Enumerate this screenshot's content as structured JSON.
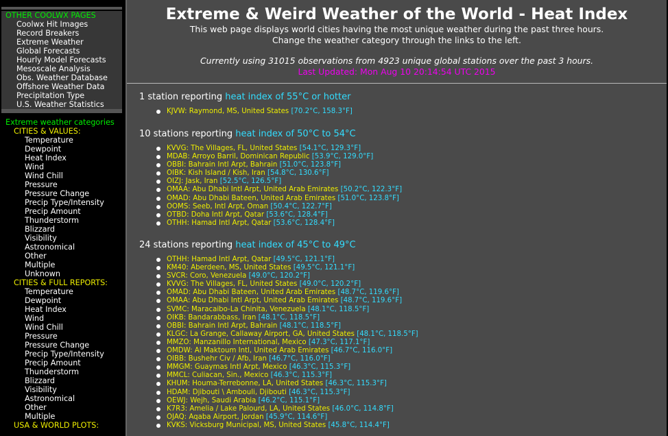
{
  "sidebar": {
    "coolwx": {
      "title": "OTHER COOLWX PAGES",
      "links": [
        "Coolwx Hit Images",
        "Record Breakers",
        "Extreme Weather",
        "Global Forecasts",
        "Hourly Model Forecasts",
        "Mesoscale Analysis",
        "Obs. Weather Database",
        "Offshore Weather Data",
        "Precipitation Type",
        "U.S. Weather Statistics"
      ]
    },
    "extreme": {
      "title": "Extreme weather categories",
      "cities_values": {
        "title": "CITIES & VALUES:",
        "links": [
          "Temperature",
          "Dewpoint",
          "Heat Index",
          "Wind",
          "Wind Chill",
          "Pressure",
          "Pressure Change",
          "Precip Type/Intensity",
          "Precip Amount",
          "Thunderstorm",
          "Blizzard",
          "Visibility",
          "Astronomical",
          "Other",
          "Multiple",
          "Unknown"
        ]
      },
      "cities_full": {
        "title": "CITIES & FULL REPORTS:",
        "links": [
          "Temperature",
          "Dewpoint",
          "Heat Index",
          "Wind",
          "Wind Chill",
          "Pressure",
          "Pressure Change",
          "Precip Type/Intensity",
          "Precip Amount",
          "Thunderstorm",
          "Blizzard",
          "Visibility",
          "Astronomical",
          "Other",
          "Multiple"
        ]
      },
      "usa_world": {
        "title": "USA & WORLD PLOTS:"
      }
    }
  },
  "main": {
    "title": "Extreme & Weird Weather of the World - Heat Index",
    "intro_1": "This web page displays world cities having the most unique weather during the past three hours.",
    "intro_2": "Change the weather category through the links to the left.",
    "obs_line": "Currently using 31015 observations from 4923 unique global stations over the past 3 hours.",
    "last_updated": "Last Updated: Mon Aug 10 20:14:54 UTC 2015",
    "groups": [
      {
        "count": "1 station reporting",
        "range": "heat index of 55°C or hotter",
        "stations": [
          {
            "name": "KJVW: Raymond, MS, United States",
            "vals": "[70.2°C, 158.3°F]"
          }
        ]
      },
      {
        "count": "10 stations reporting",
        "range": "heat index of 50°C to 54°C",
        "stations": [
          {
            "name": "KVVG: The Villages, FL, United States",
            "vals": "[54.1°C, 129.3°F]"
          },
          {
            "name": "MDAB: Arroyo Barril, Dominican Republic",
            "vals": "[53.9°C, 129.0°F]"
          },
          {
            "name": "OBBI: Bahrain Intl Arpt, Bahrain",
            "vals": "[51.0°C, 123.8°F]"
          },
          {
            "name": "OIBK: Kish Island / Kish, Iran",
            "vals": "[54.8°C, 130.6°F]"
          },
          {
            "name": "OIZJ: Jask, Iran",
            "vals": "[52.5°C, 126.5°F]"
          },
          {
            "name": "OMAA: Abu Dhabi Intl Arpt, United Arab Emirates",
            "vals": "[50.2°C, 122.3°F]"
          },
          {
            "name": "OMAD: Abu Dhabi Bateen, United Arab Emirates",
            "vals": "[51.0°C, 123.8°F]"
          },
          {
            "name": "OOMS: Seeb, Intl Arpt, Oman",
            "vals": "[50.4°C, 122.7°F]"
          },
          {
            "name": "OTBD: Doha Intl Arpt, Qatar",
            "vals": "[53.6°C, 128.4°F]"
          },
          {
            "name": "OTHH: Hamad Intl Arpt, Qatar",
            "vals": "[53.6°C, 128.4°F]"
          }
        ]
      },
      {
        "count": "24 stations reporting",
        "range": "heat index of 45°C to 49°C",
        "stations": [
          {
            "name": "OTHH: Hamad Intl Arpt, Qatar",
            "vals": "[49.5°C, 121.1°F]"
          },
          {
            "name": "KM40: Aberdeen, MS, United States",
            "vals": "[49.5°C, 121.1°F]"
          },
          {
            "name": "SVCR: Coro, Venezuela",
            "vals": "[49.0°C, 120.2°F]"
          },
          {
            "name": "KVVG: The Villages, FL, United States",
            "vals": "[49.0°C, 120.2°F]"
          },
          {
            "name": "OMAD: Abu Dhabi Bateen, United Arab Emirates",
            "vals": "[48.7°C, 119.6°F]"
          },
          {
            "name": "OMAA: Abu Dhabi Intl Arpt, United Arab Emirates",
            "vals": "[48.7°C, 119.6°F]"
          },
          {
            "name": "SVMC: Maracaibo-La Chinita, Venezuela",
            "vals": "[48.1°C, 118.5°F]"
          },
          {
            "name": "OIKB: Bandarabbass, Iran",
            "vals": "[48.1°C, 118.5°F]"
          },
          {
            "name": "OBBI: Bahrain Intl Arpt, Bahrain",
            "vals": "[48.1°C, 118.5°F]"
          },
          {
            "name": "KLGC: La Grange, Callaway Airport, GA, United States",
            "vals": "[48.1°C, 118.5°F]"
          },
          {
            "name": "MMZO: Manzanillo International, Mexico",
            "vals": "[47.3°C, 117.1°F]"
          },
          {
            "name": "OMDW: Al Maktoum Intl, United Arab Emirates",
            "vals": "[46.7°C, 116.0°F]"
          },
          {
            "name": "OIBB: Bushehr Civ / Afb, Iran",
            "vals": "[46.7°C, 116.0°F]"
          },
          {
            "name": "MMGM: Guaymas Intl Arpt, Mexico",
            "vals": "[46.3°C, 115.3°F]"
          },
          {
            "name": "MMCL: Culiacan, Sin., Mexico",
            "vals": "[46.3°C, 115.3°F]"
          },
          {
            "name": "KHUM: Houma-Terrebonne, LA, United States",
            "vals": "[46.3°C, 115.3°F]"
          },
          {
            "name": "HDAM: Djibouti \\ Ambouli, Djibouti",
            "vals": "[46.3°C, 115.3°F]"
          },
          {
            "name": "OEWJ: Wejh, Saudi Arabia",
            "vals": "[46.2°C, 115.1°F]"
          },
          {
            "name": "K7R3: Amelia / Lake Palourd, LA, United States",
            "vals": "[46.0°C, 114.8°F]"
          },
          {
            "name": "OJAQ: Aqaba Airport, Jordan",
            "vals": "[45.9°C, 114.6°F]"
          },
          {
            "name": "KVKS: Vicksburg Municipal, MS, United States",
            "vals": "[45.8°C, 114.4°F]"
          }
        ]
      }
    ]
  }
}
